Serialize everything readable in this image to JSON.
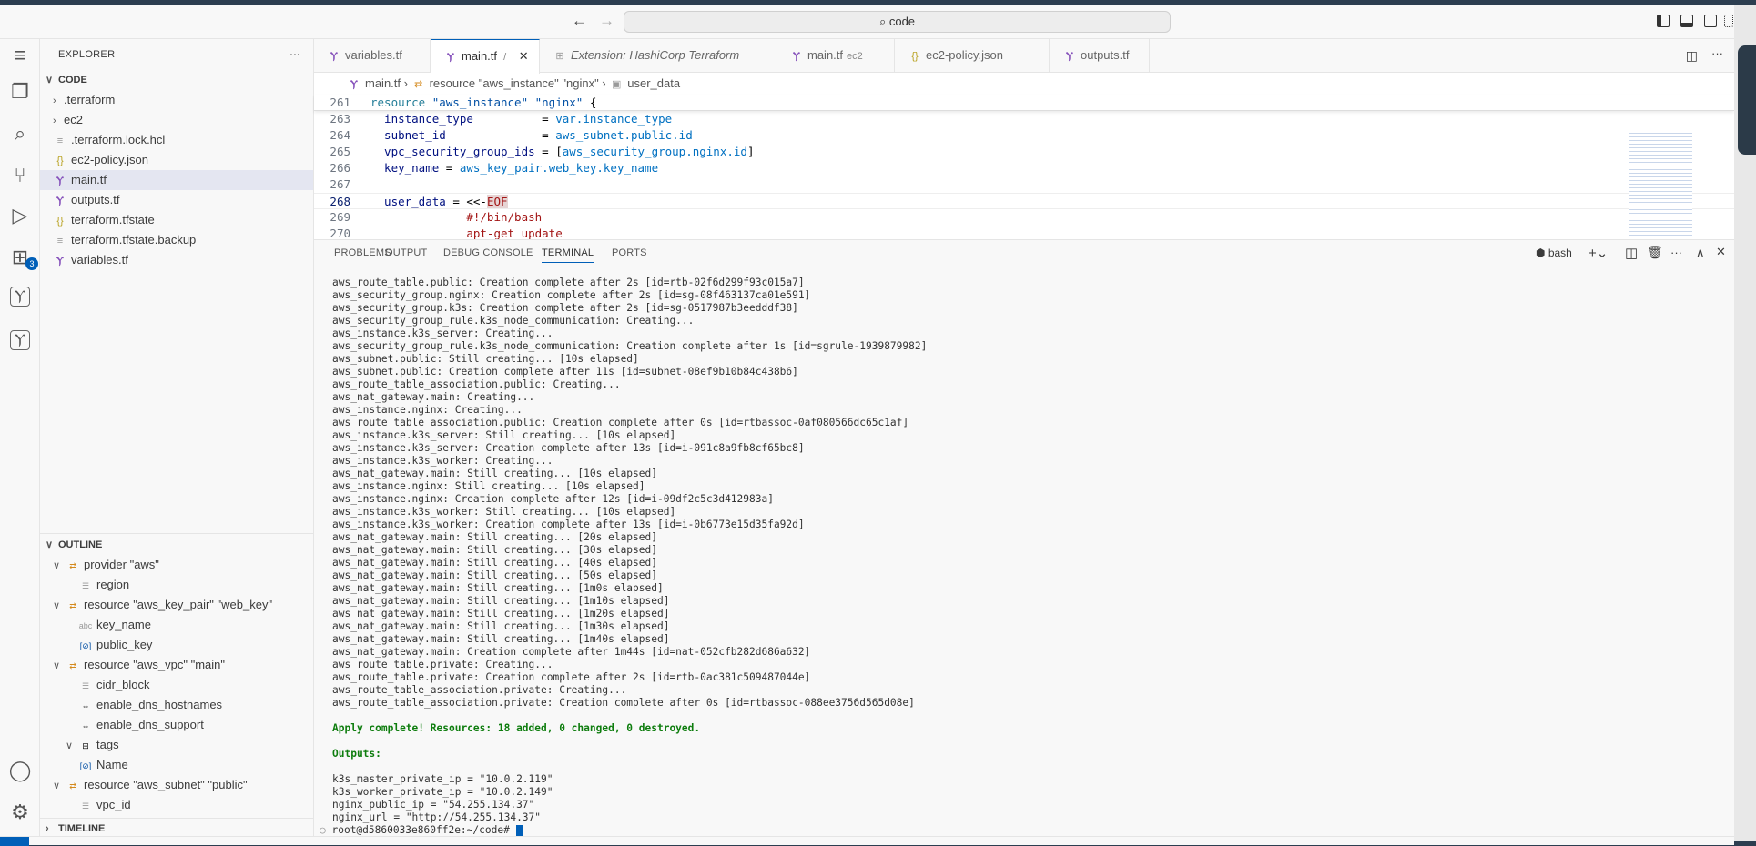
{
  "titlebar": {
    "search": "code",
    "back_icon": "arrow-left-icon",
    "forward_icon": "arrow-right-icon"
  },
  "activity": {
    "extensions_badge": "3"
  },
  "explorer": {
    "title": "EXPLORER",
    "more": "···",
    "root": "CODE",
    "items": [
      {
        "label": ".terraform",
        "type": "folder"
      },
      {
        "label": "ec2",
        "type": "folder"
      },
      {
        "label": ".terraform.lock.hcl",
        "type": "lock"
      },
      {
        "label": "ec2-policy.json",
        "type": "json"
      },
      {
        "label": "main.tf",
        "type": "tf",
        "selected": true
      },
      {
        "label": "outputs.tf",
        "type": "tf"
      },
      {
        "label": "terraform.tfstate",
        "type": "json"
      },
      {
        "label": "terraform.tfstate.backup",
        "type": "lock"
      },
      {
        "label": "variables.tf",
        "type": "tf"
      }
    ]
  },
  "outline": {
    "title": "OUTLINE",
    "items": [
      {
        "label": "provider \"aws\"",
        "depth": 0,
        "icon": "symbol-class"
      },
      {
        "label": "region",
        "depth": 1,
        "icon": "symbol-property"
      },
      {
        "label": "resource \"aws_key_pair\" \"web_key\"",
        "depth": 0,
        "icon": "symbol-class"
      },
      {
        "label": "key_name",
        "depth": 1,
        "icon": "symbol-string"
      },
      {
        "label": "public_key",
        "depth": 1,
        "icon": "symbol-variable"
      },
      {
        "label": "resource \"aws_vpc\" \"main\"",
        "depth": 0,
        "icon": "symbol-class"
      },
      {
        "label": "cidr_block",
        "depth": 1,
        "icon": "symbol-property"
      },
      {
        "label": "enable_dns_hostnames",
        "depth": 1,
        "icon": "symbol-boolean"
      },
      {
        "label": "enable_dns_support",
        "depth": 1,
        "icon": "symbol-boolean"
      },
      {
        "label": "tags",
        "depth": 1,
        "icon": "symbol-struct",
        "expandable": true
      },
      {
        "label": "Name",
        "depth": 2,
        "icon": "symbol-variable"
      },
      {
        "label": "resource \"aws_subnet\" \"public\"",
        "depth": 0,
        "icon": "symbol-class"
      },
      {
        "label": "vpc_id",
        "depth": 1,
        "icon": "symbol-property"
      }
    ]
  },
  "timeline": {
    "title": "TIMELINE"
  },
  "tabs": [
    {
      "label": "variables.tf",
      "icon": "terraform"
    },
    {
      "label": "main.tf",
      "sub": "./",
      "icon": "terraform",
      "active": true
    },
    {
      "label": "Extension: HashiCorp Terraform",
      "icon": "extension",
      "italic": true
    },
    {
      "label": "main.tf",
      "sub": "ec2",
      "icon": "terraform"
    },
    {
      "label": "ec2-policy.json",
      "icon": "json"
    },
    {
      "label": "outputs.tf",
      "icon": "terraform"
    }
  ],
  "breadcrumb": [
    "main.tf",
    "resource \"aws_instance\" \"nginx\"",
    "user_data"
  ],
  "code": [
    {
      "n": "261",
      "segs": [
        [
          "t",
          "resource "
        ],
        [
          "s",
          "\"aws_instance\" \"nginx\" "
        ],
        [
          "p",
          "{"
        ]
      ]
    },
    {
      "n": "263",
      "segs": [
        [
          "k",
          "  instance_type          "
        ],
        [
          "p",
          "= "
        ],
        [
          "v",
          "var.instance_type"
        ]
      ]
    },
    {
      "n": "264",
      "segs": [
        [
          "k",
          "  subnet_id              "
        ],
        [
          "p",
          "= "
        ],
        [
          "v",
          "aws_subnet.public.id"
        ]
      ]
    },
    {
      "n": "265",
      "segs": [
        [
          "k",
          "  vpc_security_group_ids "
        ],
        [
          "p",
          "= ["
        ],
        [
          "v",
          "aws_security_group.nginx.id"
        ],
        [
          "p",
          "]"
        ]
      ]
    },
    {
      "n": "266",
      "segs": [
        [
          "k",
          "  key_name "
        ],
        [
          "p",
          "= "
        ],
        [
          "v",
          "aws_key_pair.web_key.key_name"
        ]
      ]
    },
    {
      "n": "267",
      "segs": []
    },
    {
      "n": "268",
      "segs": [
        [
          "k",
          "  user_data "
        ],
        [
          "p",
          "= <<-"
        ],
        [
          "eof",
          "EOF"
        ]
      ]
    },
    {
      "n": "269",
      "segs": [
        [
          "r",
          "              #!/bin/bash"
        ]
      ]
    },
    {
      "n": "270",
      "segs": [
        [
          "r",
          "              apt-get update"
        ]
      ]
    }
  ],
  "panel": {
    "tabs": [
      "PROBLEMS",
      "OUTPUT",
      "DEBUG CONSOLE",
      "TERMINAL",
      "PORTS"
    ],
    "active": "TERMINAL",
    "shell": "bash"
  },
  "terminal": {
    "lines": [
      "aws_route_table.public: Creation complete after 2s [id=rtb-02f6d299f93c015a7]",
      "aws_security_group.nginx: Creation complete after 2s [id=sg-08f463137ca01e591]",
      "aws_security_group.k3s: Creation complete after 2s [id=sg-0517987b3eedddf38]",
      "aws_security_group_rule.k3s_node_communication: Creating...",
      "aws_instance.k3s_server: Creating...",
      "aws_security_group_rule.k3s_node_communication: Creation complete after 1s [id=sgrule-1939879982]",
      "aws_subnet.public: Still creating... [10s elapsed]",
      "aws_subnet.public: Creation complete after 11s [id=subnet-08ef9b10b84c438b6]",
      "aws_route_table_association.public: Creating...",
      "aws_nat_gateway.main: Creating...",
      "aws_instance.nginx: Creating...",
      "aws_route_table_association.public: Creation complete after 0s [id=rtbassoc-0af080566dc65c1af]",
      "aws_instance.k3s_server: Still creating... [10s elapsed]",
      "aws_instance.k3s_server: Creation complete after 13s [id=i-091c8a9fb8cf65bc8]",
      "aws_instance.k3s_worker: Creating...",
      "aws_nat_gateway.main: Still creating... [10s elapsed]",
      "aws_instance.nginx: Still creating... [10s elapsed]",
      "aws_instance.nginx: Creation complete after 12s [id=i-09df2c5c3d412983a]",
      "aws_instance.k3s_worker: Still creating... [10s elapsed]",
      "aws_instance.k3s_worker: Creation complete after 13s [id=i-0b6773e15d35fa92d]",
      "aws_nat_gateway.main: Still creating... [20s elapsed]",
      "aws_nat_gateway.main: Still creating... [30s elapsed]",
      "aws_nat_gateway.main: Still creating... [40s elapsed]",
      "aws_nat_gateway.main: Still creating... [50s elapsed]",
      "aws_nat_gateway.main: Still creating... [1m0s elapsed]",
      "aws_nat_gateway.main: Still creating... [1m10s elapsed]",
      "aws_nat_gateway.main: Still creating... [1m20s elapsed]",
      "aws_nat_gateway.main: Still creating... [1m30s elapsed]",
      "aws_nat_gateway.main: Still creating... [1m40s elapsed]",
      "aws_nat_gateway.main: Creation complete after 1m44s [id=nat-052cfb282d686a632]",
      "aws_route_table.private: Creating...",
      "aws_route_table.private: Creation complete after 2s [id=rtb-0ac381c509487044e]",
      "aws_route_table_association.private: Creating...",
      "aws_route_table_association.private: Creation complete after 0s [id=rtbassoc-088ee3756d565d08e]",
      "",
      {
        "text": "Apply complete! Resources: 18 added, 0 changed, 0 destroyed.",
        "green": true
      },
      "",
      {
        "text": "Outputs:",
        "green": true
      },
      "",
      "k3s_master_private_ip = \"10.0.2.119\"",
      "k3s_worker_private_ip = \"10.0.2.149\"",
      "nginx_public_ip = \"54.255.134.37\"",
      "nginx_url = \"http://54.255.134.37\""
    ],
    "prompt": "root@d5860033e860ff2e:~/code#"
  },
  "colors": {
    "accent": "#005fb8",
    "terraform": "#844fba",
    "success": "#0e7d0e"
  }
}
